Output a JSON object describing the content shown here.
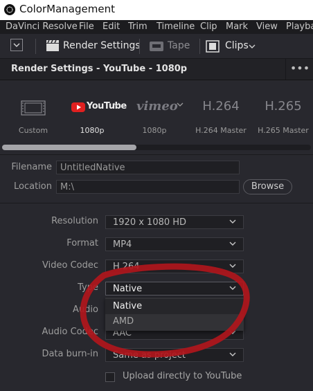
{
  "window": {
    "title": "ColorManagement"
  },
  "menubar": [
    "DaVinci Resolve",
    "File",
    "Edit",
    "Trim",
    "Timeline",
    "Clip",
    "Mark",
    "View",
    "Playba"
  ],
  "toolbar": {
    "render_settings_label": "Render Settings",
    "tape_label": "Tape",
    "clips_label": "Clips"
  },
  "panel": {
    "title": "Render Settings - YouTube - 1080p",
    "menu_glyph": "•••"
  },
  "presets": [
    {
      "logo": "",
      "label": "Custom",
      "active": false
    },
    {
      "logo": "YouTube",
      "label": "1080p",
      "active": true
    },
    {
      "logo": "vimeo",
      "label": "1080p",
      "active": false
    },
    {
      "logo": "H.264",
      "label": "H.264 Master",
      "active": false
    },
    {
      "logo": "H.265",
      "label": "H.265 Master",
      "active": false
    }
  ],
  "file": {
    "filename_label": "Filename",
    "filename_value": "UntitledNative",
    "location_label": "Location",
    "location_value": "M:\\",
    "browse_label": "Browse"
  },
  "settings": {
    "resolution_label": "Resolution",
    "resolution_value": "1920 x 1080 HD",
    "format_label": "Format",
    "format_value": "MP4",
    "codec_label": "Video Codec",
    "codec_value": "H.264",
    "type_label": "Type",
    "type_value": "Native",
    "audio_label": "Audio",
    "audio_codec_label": "Audio Codec",
    "audio_codec_value": "AAC",
    "burnin_label": "Data burn-in",
    "burnin_value": "Same as project",
    "upload_label": "Upload directly to YouTube"
  },
  "type_menu": {
    "options": [
      "Native",
      "AMD"
    ]
  },
  "annotation": {
    "color": "#b0161c"
  }
}
